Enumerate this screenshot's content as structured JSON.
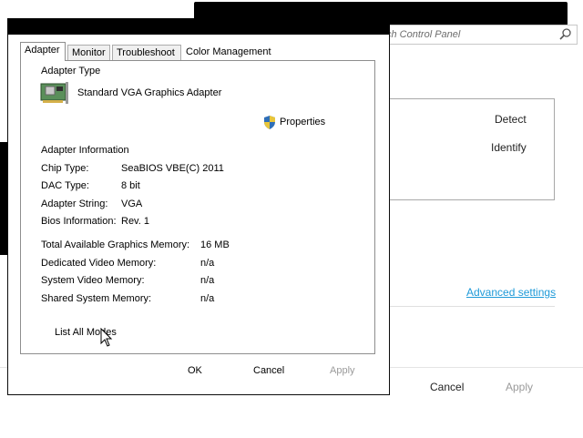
{
  "background_window": {
    "search_placeholder": "ch Control Panel",
    "detect_label": "Detect",
    "identify_label": "Identify",
    "advanced_link": "Advanced settings",
    "cancel_label": "Cancel",
    "apply_label": "Apply"
  },
  "dialog": {
    "tabs": [
      {
        "label": "Adapter",
        "active": true
      },
      {
        "label": "Monitor",
        "active": false
      },
      {
        "label": "Troubleshoot",
        "active": false
      },
      {
        "label": "Color Management",
        "active": false
      }
    ],
    "adapter_type_heading": "Adapter Type",
    "adapter_name": "Standard VGA Graphics Adapter",
    "properties_label": "Properties",
    "adapter_info_heading": "Adapter Information",
    "info_rows": [
      {
        "label": "Chip Type:",
        "value": "SeaBIOS VBE(C) 2011"
      },
      {
        "label": "DAC Type:",
        "value": "8 bit"
      },
      {
        "label": "Adapter String:",
        "value": "VGA"
      },
      {
        "label": "Bios Information:",
        "value": "Rev. 1"
      }
    ],
    "memory_rows": [
      {
        "label": "Total Available Graphics Memory:",
        "value": "16 MB"
      },
      {
        "label": "Dedicated Video Memory:",
        "value": "n/a"
      },
      {
        "label": "System Video Memory:",
        "value": "n/a"
      },
      {
        "label": "Shared System Memory:",
        "value": "n/a"
      }
    ],
    "list_all_modes_label": "List All Modes",
    "ok_label": "OK",
    "cancel_label": "Cancel",
    "apply_label": "Apply"
  },
  "icons": {
    "adapter": "graphics-card-icon",
    "shield": "uac-shield-icon",
    "search": "search-icon",
    "cursor": "mouse-pointer-icon"
  },
  "colors": {
    "link": "#1e9ad8",
    "disabled_text": "#9a9a9a",
    "titlebar": "#000000"
  }
}
